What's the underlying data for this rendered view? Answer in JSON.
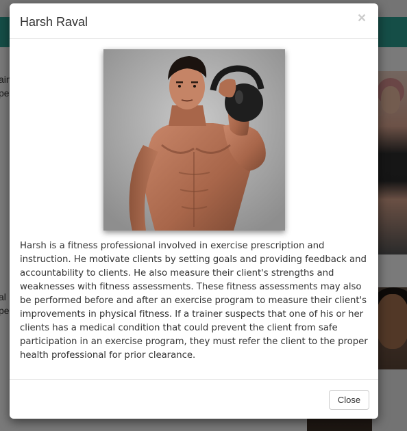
{
  "background": {
    "snippets": [
      "ain",
      "pet",
      "al",
      "pet"
    ]
  },
  "modal": {
    "title": "Harsh Raval",
    "close_symbol": "×",
    "close_icon": "close-icon",
    "bio": "Harsh is a fitness professional involved in exercise prescription and instruction. He motivate clients by setting goals and providing feedback and accountability to clients. He also measure their client's strengths and weaknesses with fitness assessments. These fitness assessments may also be performed before and after an exercise program to measure their client's improvements in physical fitness. If a trainer suspects that one of his or her clients has a medical condition that could prevent the client from safe participation in an exercise program, they must refer the client to the proper health professional for prior clearance.",
    "footer_button": "Close"
  },
  "colors": {
    "navbar": "#2a9d8f",
    "backdrop": "rgba(0,0,0,0.5)",
    "title_text": "#333333",
    "border": "#e5e5e5"
  }
}
